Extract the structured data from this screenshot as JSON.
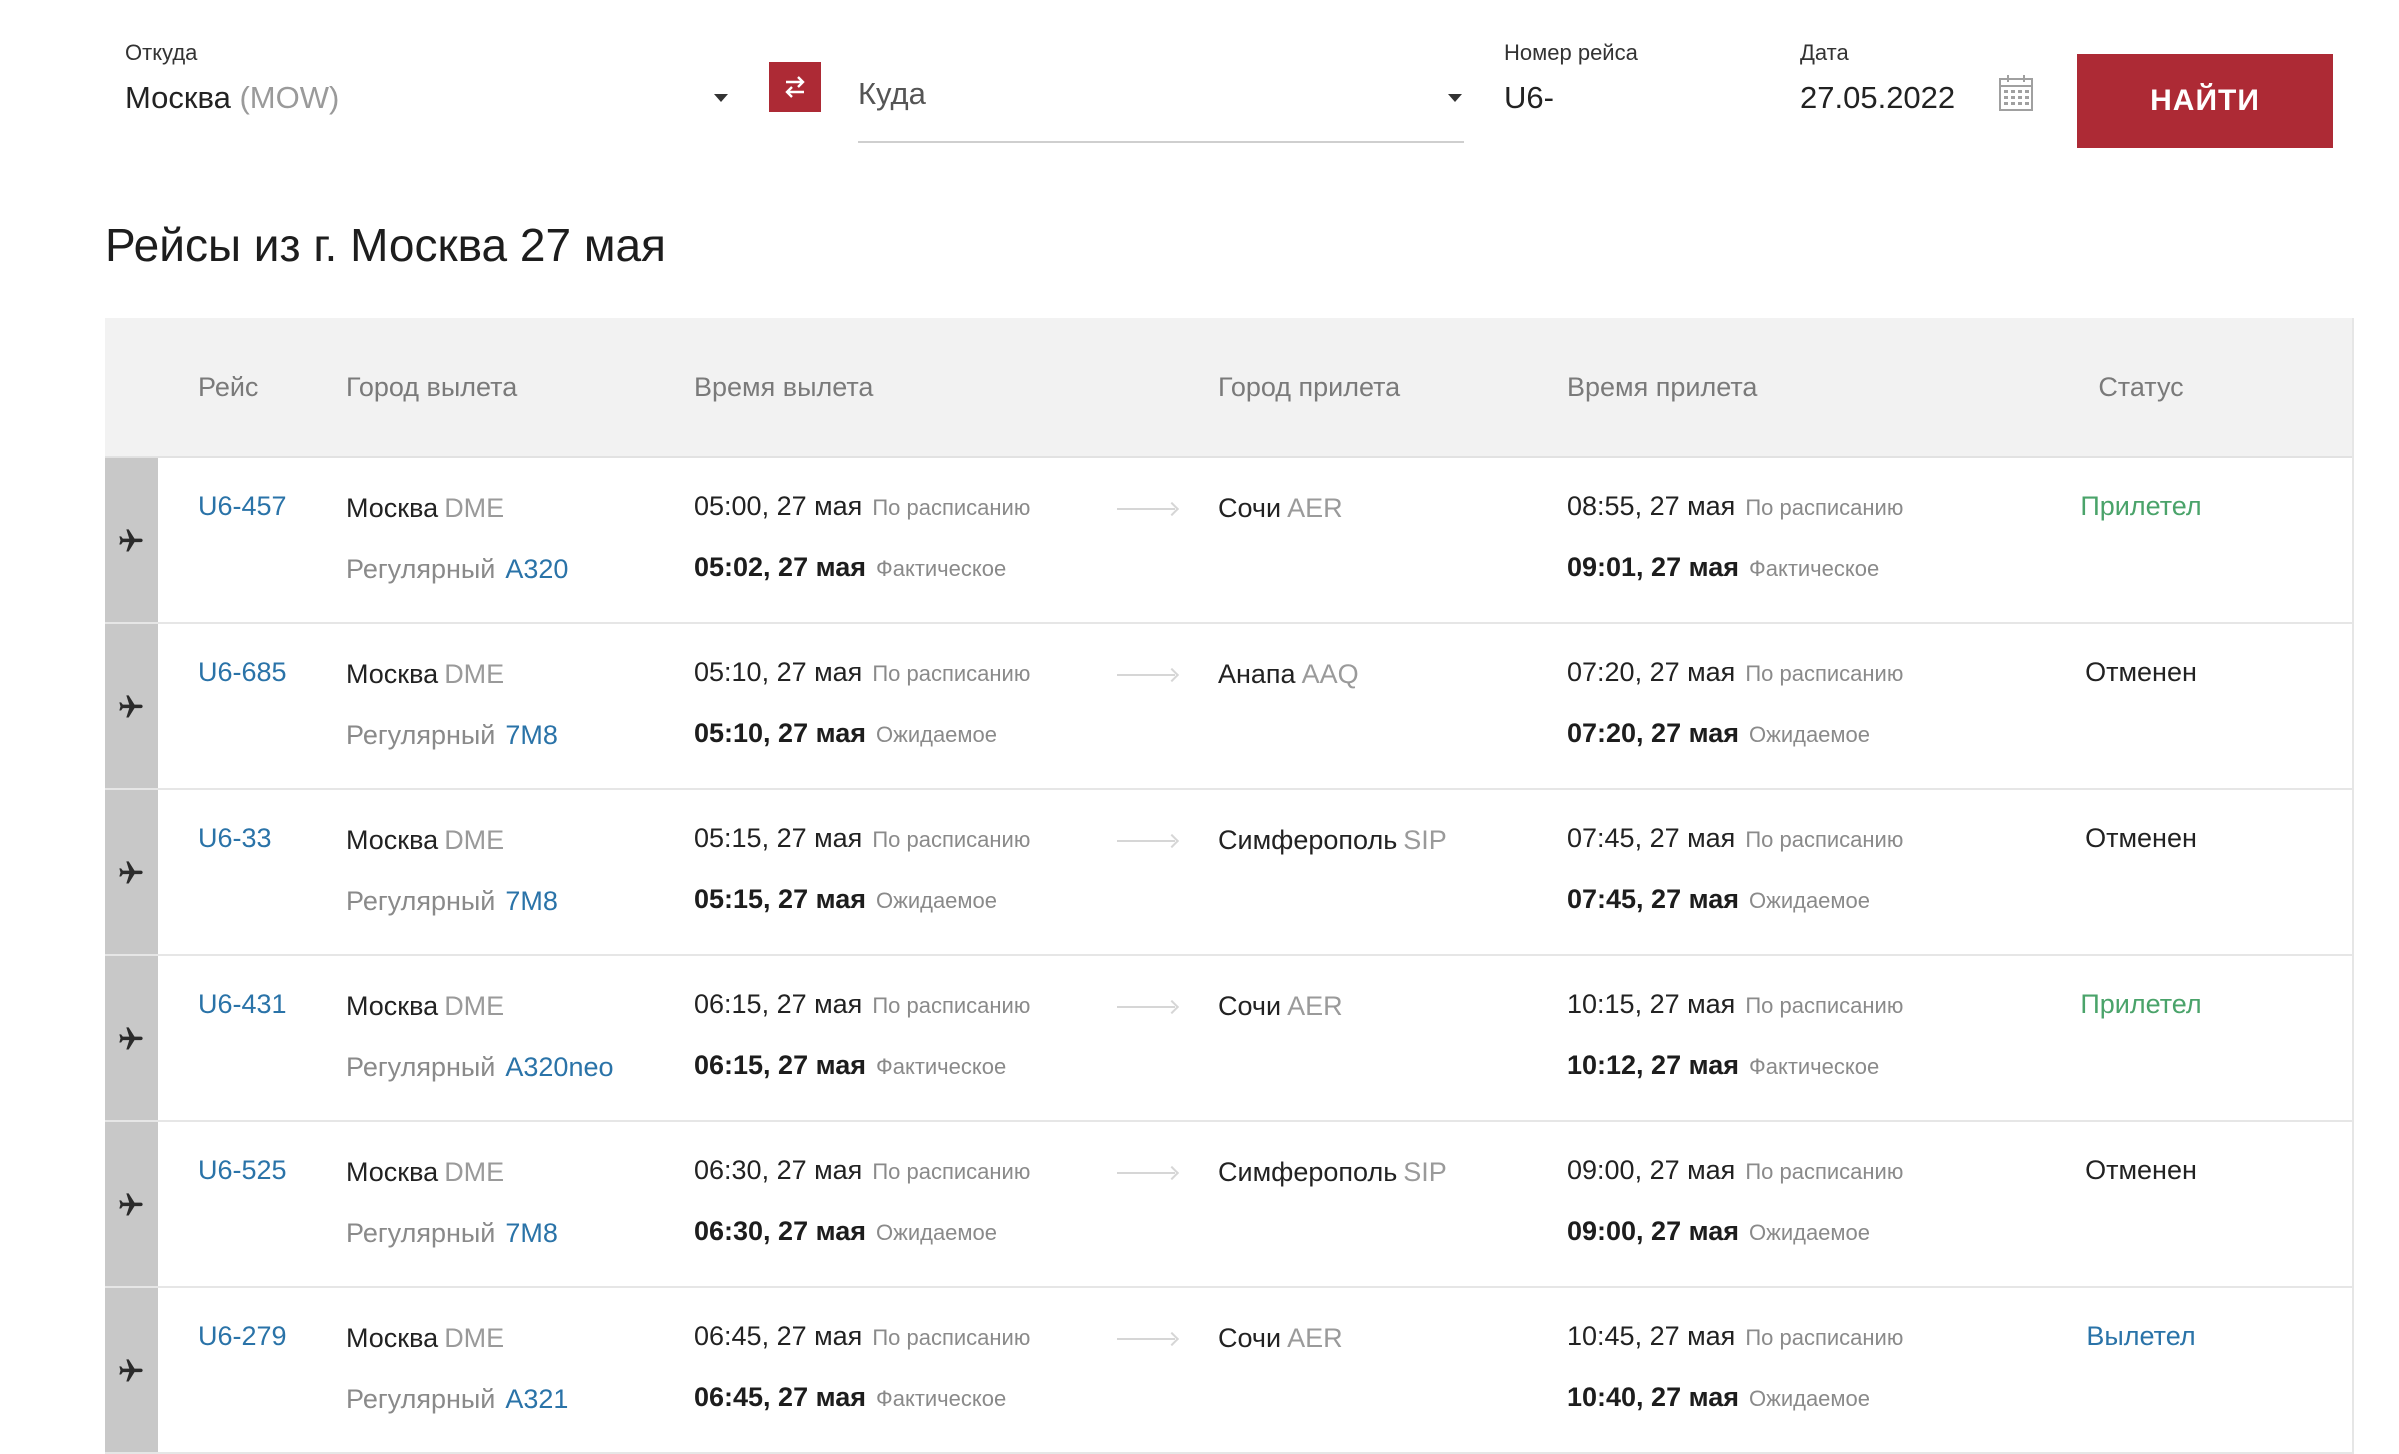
{
  "colors": {
    "accent": "#ad2a35",
    "link": "#2a73a8",
    "status_arrived": "#4aa36a",
    "status_cancelled": "#222222",
    "status_departed": "#2a73a8"
  },
  "search": {
    "from_label": "Откуда",
    "from_city": "Москва",
    "from_code": "(MOW)",
    "swap_icon": "swap-arrows-icon",
    "to_placeholder": "Куда",
    "flight_number_label": "Номер рейса",
    "flight_number_value": "U6-",
    "date_label": "Дата",
    "date_value": "27.05.2022",
    "calendar_icon": "calendar-icon",
    "find_button": "НАЙТИ"
  },
  "page_title": "Рейсы из г. Москва 27 мая",
  "table": {
    "headers": {
      "flight": "Рейс",
      "dep_city": "Город вылета",
      "dep_time": "Время вылета",
      "arr_city": "Город прилета",
      "arr_time": "Время прилета",
      "status": "Статус"
    },
    "rows": [
      {
        "flight": "U6-457",
        "dep_city": "Москва",
        "dep_code": "DME",
        "type": "Регулярный",
        "aircraft": "A320",
        "dep_sched": "05:00, 27 мая",
        "dep_sched_note": "По расписанию",
        "dep_act": "05:02, 27 мая",
        "dep_act_note": "Фактическое",
        "arr_city": "Сочи",
        "arr_code": "AER",
        "arr_sched": "08:55, 27 мая",
        "arr_sched_note": "По расписанию",
        "arr_act": "09:01, 27 мая",
        "arr_act_note": "Фактическое",
        "status": "Прилетел",
        "status_kind": "arrived"
      },
      {
        "flight": "U6-685",
        "dep_city": "Москва",
        "dep_code": "DME",
        "type": "Регулярный",
        "aircraft": "7M8",
        "dep_sched": "05:10, 27 мая",
        "dep_sched_note": "По расписанию",
        "dep_act": "05:10, 27 мая",
        "dep_act_note": "Ожидаемое",
        "arr_city": "Анапа",
        "arr_code": "AAQ",
        "arr_sched": "07:20, 27 мая",
        "arr_sched_note": "По расписанию",
        "arr_act": "07:20, 27 мая",
        "arr_act_note": "Ожидаемое",
        "status": "Отменен",
        "status_kind": "cancelled"
      },
      {
        "flight": "U6-33",
        "dep_city": "Москва",
        "dep_code": "DME",
        "type": "Регулярный",
        "aircraft": "7M8",
        "dep_sched": "05:15, 27 мая",
        "dep_sched_note": "По расписанию",
        "dep_act": "05:15, 27 мая",
        "dep_act_note": "Ожидаемое",
        "arr_city": "Симферополь",
        "arr_code": "SIP",
        "arr_sched": "07:45, 27 мая",
        "arr_sched_note": "По расписанию",
        "arr_act": "07:45, 27 мая",
        "arr_act_note": "Ожидаемое",
        "status": "Отменен",
        "status_kind": "cancelled"
      },
      {
        "flight": "U6-431",
        "dep_city": "Москва",
        "dep_code": "DME",
        "type": "Регулярный",
        "aircraft": "A320neo",
        "dep_sched": "06:15, 27 мая",
        "dep_sched_note": "По расписанию",
        "dep_act": "06:15, 27 мая",
        "dep_act_note": "Фактическое",
        "arr_city": "Сочи",
        "arr_code": "AER",
        "arr_sched": "10:15, 27 мая",
        "arr_sched_note": "По расписанию",
        "arr_act": "10:12, 27 мая",
        "arr_act_note": "Фактическое",
        "status": "Прилетел",
        "status_kind": "arrived"
      },
      {
        "flight": "U6-525",
        "dep_city": "Москва",
        "dep_code": "DME",
        "type": "Регулярный",
        "aircraft": "7M8",
        "dep_sched": "06:30, 27 мая",
        "dep_sched_note": "По расписанию",
        "dep_act": "06:30, 27 мая",
        "dep_act_note": "Ожидаемое",
        "arr_city": "Симферополь",
        "arr_code": "SIP",
        "arr_sched": "09:00, 27 мая",
        "arr_sched_note": "По расписанию",
        "arr_act": "09:00, 27 мая",
        "arr_act_note": "Ожидаемое",
        "status": "Отменен",
        "status_kind": "cancelled"
      },
      {
        "flight": "U6-279",
        "dep_city": "Москва",
        "dep_code": "DME",
        "type": "Регулярный",
        "aircraft": "A321",
        "dep_sched": "06:45, 27 мая",
        "dep_sched_note": "По расписанию",
        "dep_act": "06:45, 27 мая",
        "dep_act_note": "Фактическое",
        "arr_city": "Сочи",
        "arr_code": "AER",
        "arr_sched": "10:45, 27 мая",
        "arr_sched_note": "По расписанию",
        "arr_act": "10:40, 27 мая",
        "arr_act_note": "Ожидаемое",
        "status": "Вылетел",
        "status_kind": "departed"
      }
    ]
  }
}
